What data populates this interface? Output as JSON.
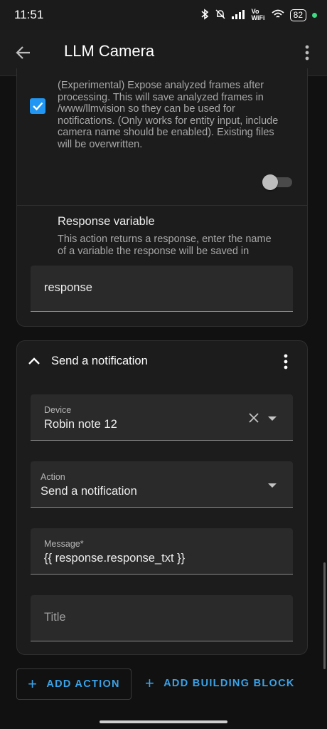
{
  "status_bar": {
    "time": "11:51",
    "network": "Vo WiFi",
    "battery": "82"
  },
  "app_bar": {
    "title": "LLM Camera"
  },
  "expose_frames": {
    "checked": true,
    "description": "(Experimental) Expose analyzed frames after processing. This will save analyzed frames in /www/llmvision so they can be used for notifications. (Only works for entity input, include camera name should be enabled). Existing files will be overwritten.",
    "toggle_on": false
  },
  "response_variable": {
    "heading": "Response variable",
    "description": "This action returns a response, enter the name of a variable the response will be saved in",
    "value": "response"
  },
  "notification_card": {
    "title": "Send a notification",
    "device_label": "Device",
    "device_value": "Robin note 12",
    "action_label": "Action",
    "action_value": "Send a notification",
    "message_label": "Message*",
    "message_value": "{{ response.response_txt }}",
    "title_placeholder": "Title"
  },
  "footer": {
    "add_action": "ADD ACTION",
    "add_building_block": "ADD BUILDING BLOCK"
  },
  "colors": {
    "accent": "#2196f3",
    "link": "#3aa2e8",
    "background": "#111111",
    "card": "#1c1c1c"
  }
}
